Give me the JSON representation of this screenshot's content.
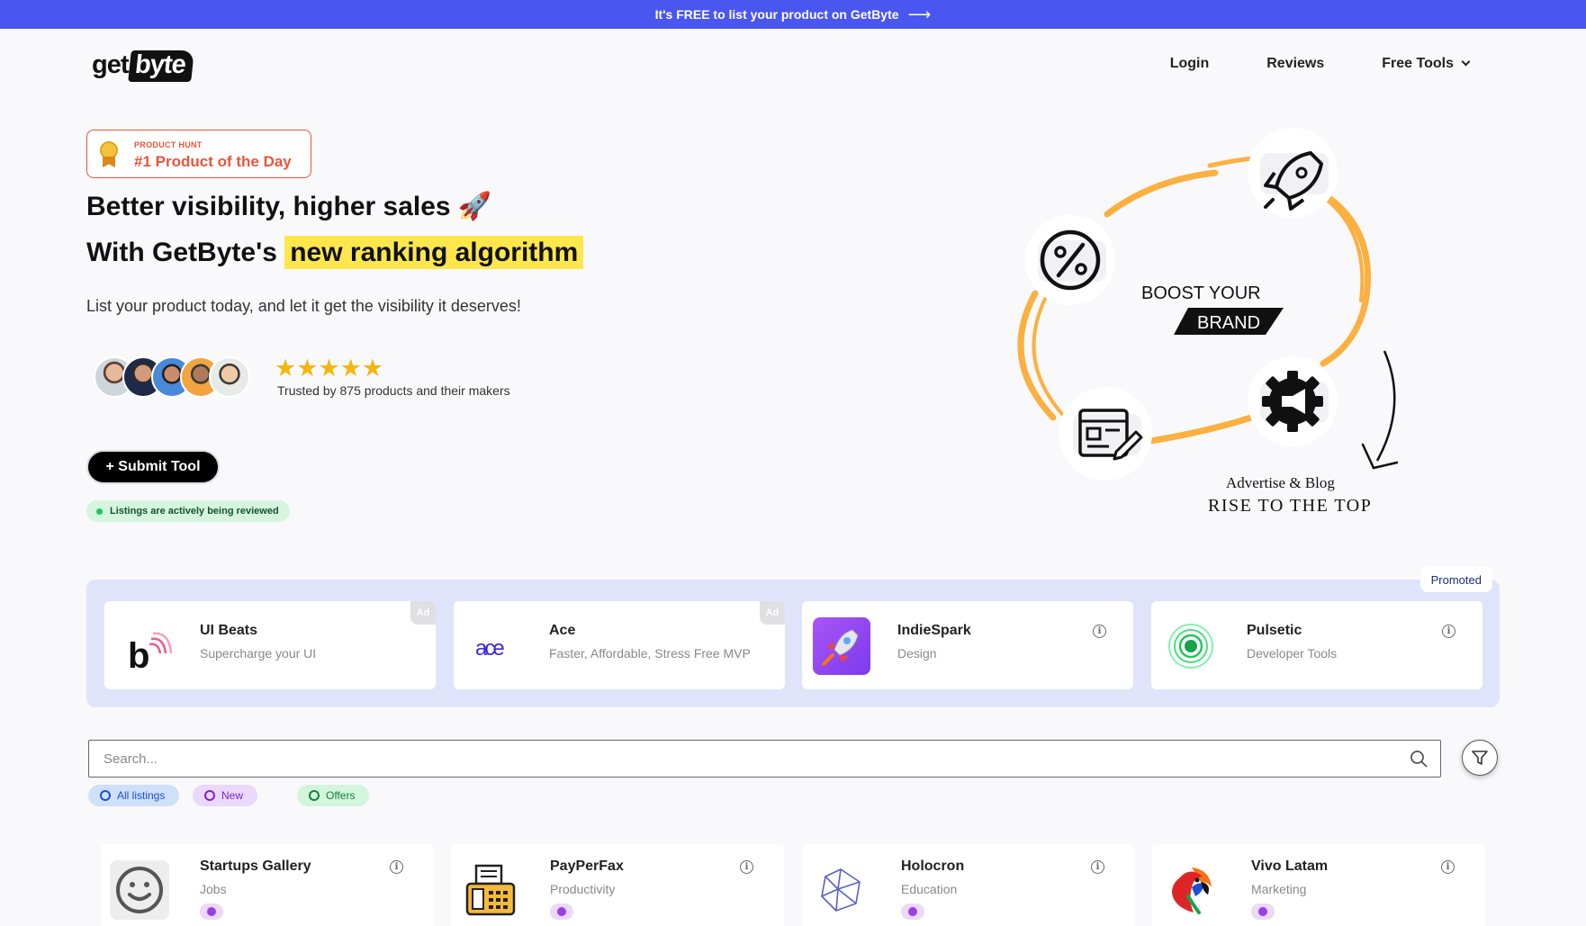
{
  "banner": {
    "text": "It's FREE to list your product on GetByte",
    "arrow": "⟶"
  },
  "logo": {
    "part1": "get",
    "part2": "byte"
  },
  "nav": {
    "login": "Login",
    "reviews": "Reviews",
    "free_tools": "Free Tools"
  },
  "product_hunt": {
    "label": "PRODUCT HUNT",
    "title": "#1 Product of the Day"
  },
  "hero": {
    "line1": "Better visibility, higher sales 🚀",
    "line2_prefix": "With GetByte's ",
    "line2_highlight": "new ranking algorithm",
    "subtitle": "List your product today, and let it get the visibility it deserves!",
    "stars": "★★★★★",
    "rating_value": 5,
    "trusted": "Trusted by 875 products and their makers",
    "submit": "+ Submit Tool",
    "status": "Listings are actively being reviewed"
  },
  "hero_art": {
    "line1": "BOOST YOUR",
    "line2": "BRAND",
    "line3": "Advertise & Blog",
    "line4": "RISE TO THE TOP",
    "accent": "#fbb040"
  },
  "promoted": {
    "tag": "Promoted",
    "cards": [
      {
        "name": "UI Beats",
        "desc": "Supercharge your UI",
        "ad": "Ad"
      },
      {
        "name": "Ace",
        "desc": "Faster, Affordable, Stress Free MVP",
        "ad": "Ad"
      },
      {
        "name": "IndieSpark",
        "desc": "Design"
      },
      {
        "name": "Pulsetic",
        "desc": "Developer Tools"
      }
    ]
  },
  "search": {
    "placeholder": "Search..."
  },
  "filters": [
    {
      "label": "All listings",
      "bg": "#cfe0fb",
      "color": "#1d4ed8"
    },
    {
      "label": "New",
      "bg": "#ead9fb",
      "color": "#7e22ce"
    },
    {
      "label": "Offers",
      "bg": "#d3f5dc",
      "color": "#15803d"
    }
  ],
  "listings": [
    {
      "name": "Startups Gallery",
      "category": "Jobs"
    },
    {
      "name": "PayPerFax",
      "category": "Productivity"
    },
    {
      "name": "Holocron",
      "category": "Education"
    },
    {
      "name": "Vivo Latam",
      "category": "Marketing"
    }
  ],
  "colors": {
    "banner": "#4a56f0",
    "highlight": "#fde74c",
    "promo_bg": "#e0e4fb",
    "product_hunt": "#e8553a"
  }
}
